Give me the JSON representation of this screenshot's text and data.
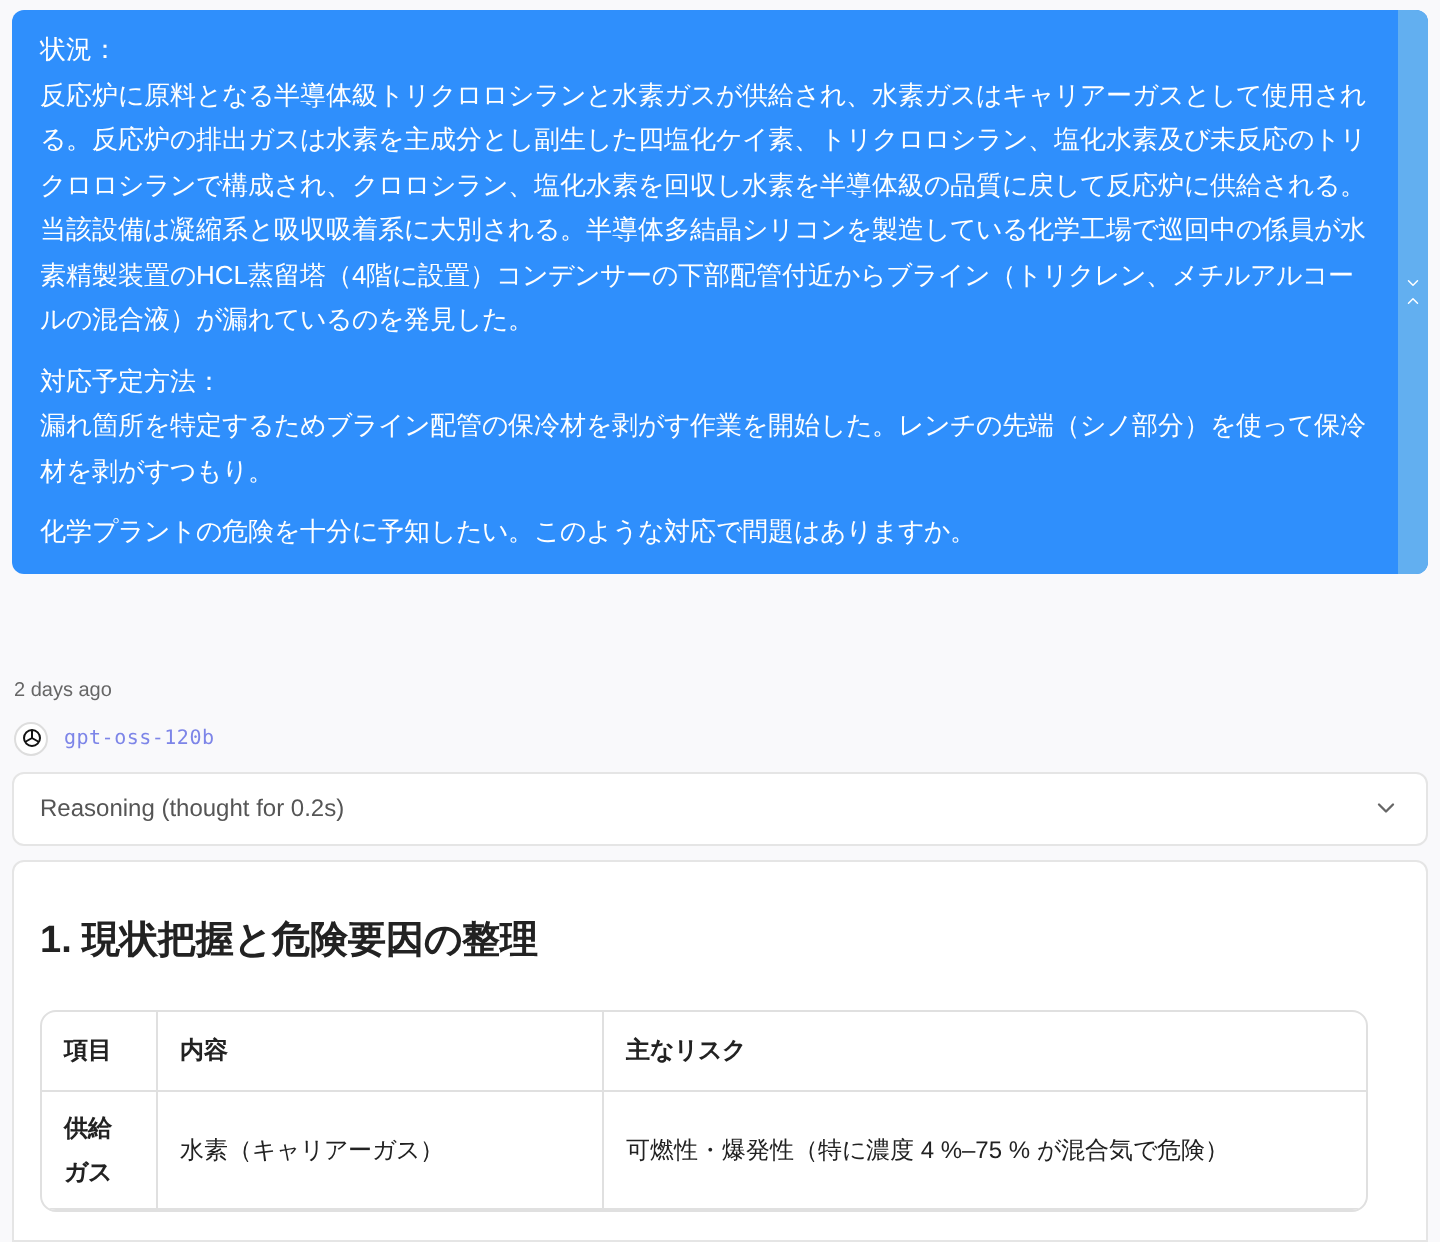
{
  "user_message": {
    "sections": [
      {
        "lines": [
          "状況：",
          "反応炉に原料となる半導体級トリクロロシランと水素ガスが供給され、水素ガスはキャリアーガスとして使用される。反応炉の排出ガスは水素を主成分とし副生した四塩化ケイ素、トリクロロシラン、塩化水素及び未反応のトリクロロシランで構成され、クロロシラン、塩化水素を回収し水素を半導体級の品質に戻して反応炉に供給される。",
          "当該設備は凝縮系と吸収吸着系に大別される。半導体多結晶シリコンを製造している化学工場で巡回中の係員が水素精製装置のHCL蒸留塔（4階に設置）コンデンサーの下部配管付近からブライン（トリクレン、メチルアルコールの混合液）が漏れているのを発見した。"
        ]
      },
      {
        "lines": [
          "対応予定方法：",
          "漏れ箇所を特定するためブライン配管の保冷材を剥がす作業を開始した。レンチの先端（シノ部分）を使って保冷材を剥がすつもり。"
        ]
      },
      {
        "lines": [
          "化学プラントの危険を十分に予知したい。このような対応で問題はありますか。"
        ]
      }
    ]
  },
  "timestamp": "2 days ago",
  "model": "gpt-oss-120b",
  "reasoning": {
    "label": "Reasoning (thought for 0.2s)",
    "expanded": false
  },
  "answer": {
    "heading": "1. 現状把握と危険要因の整理",
    "table": {
      "columns": [
        "項目",
        "内容",
        "主なリスク"
      ],
      "rows": [
        [
          "供給ガス",
          "水素（キャリアーガス）",
          "可燃性・爆発性（特に濃度 4 %–75 % が混合気で危険）"
        ]
      ]
    }
  }
}
